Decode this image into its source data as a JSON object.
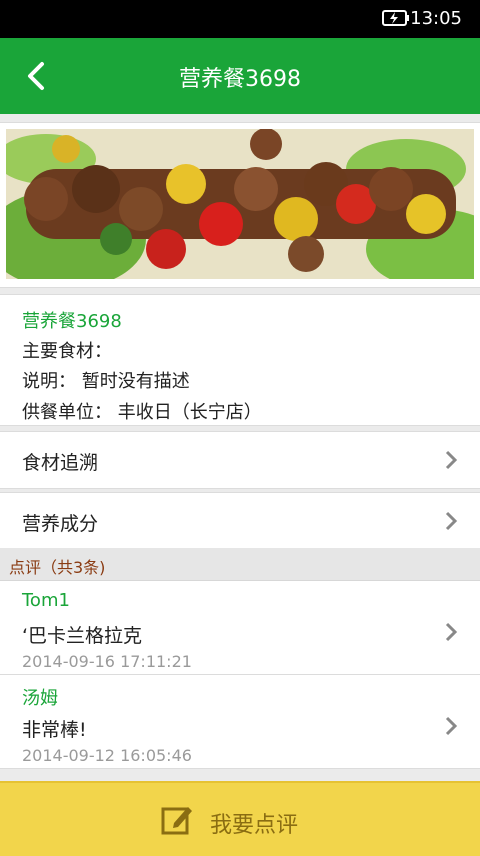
{
  "status_bar": {
    "time": "13:05",
    "battery_icon": "battery-charging-icon"
  },
  "header": {
    "title": "营养餐3698",
    "back_icon": "back-arrow-icon"
  },
  "banner": {
    "image": "meat-skewers-photo"
  },
  "info": {
    "name": "营养餐3698",
    "ingredients": "主要食材：",
    "description": "说明： 暂时没有描述",
    "supplier": "供餐单位： 丰收日（长宁店）"
  },
  "menu": {
    "trace": "食材追溯",
    "nutrition": "营养成分"
  },
  "reviews_section": {
    "title": "点评（共3条)"
  },
  "reviews": [
    {
      "author": "Tom1",
      "text": "‘巴卡兰格拉克",
      "date": "2014-09-16 17:11:21"
    },
    {
      "author": "汤姆",
      "text": "非常棒!",
      "date": "2014-09-12 16:05:46"
    }
  ],
  "bottom_bar": {
    "label": "我要点评",
    "icon": "edit-icon"
  },
  "colors": {
    "primary": "#1aa539",
    "bottom_bar": "#f2d54b",
    "section_text": "#8a3b12"
  }
}
